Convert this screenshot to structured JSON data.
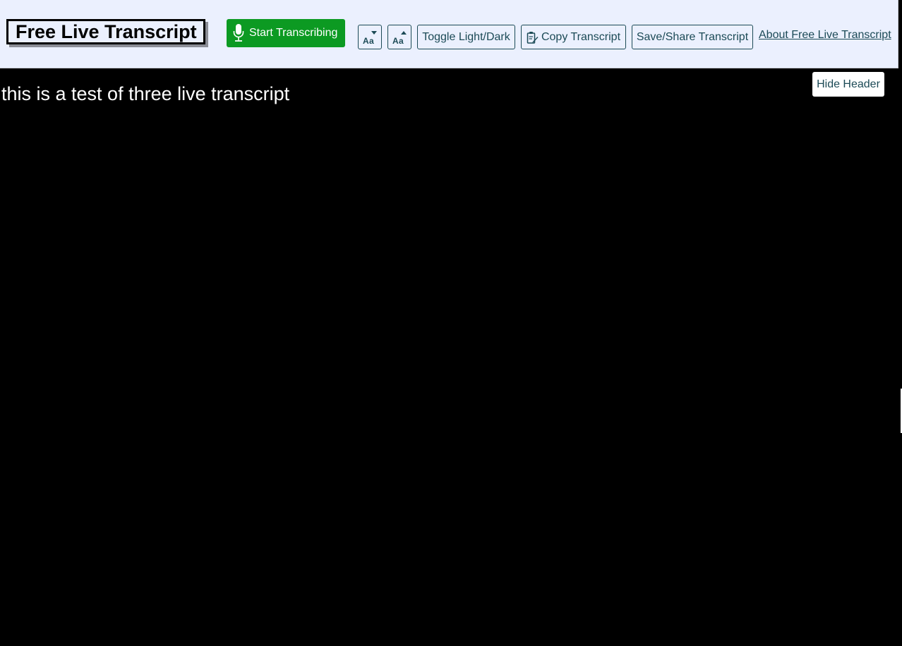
{
  "header": {
    "title": "Free Live Transcript",
    "start_button": "Start Transcribing",
    "toggle_theme": "Toggle Light/Dark",
    "copy_transcript": "Copy Transcript",
    "save_share": "Save/Share Transcript",
    "about_link": "About Free Live Transcript",
    "icons": {
      "start": "microphone-icon",
      "decrease_font": "decrease-text-size-icon",
      "increase_font": "increase-text-size-icon",
      "copy": "clipboard-edit-icon"
    }
  },
  "transcript": {
    "text": "this is a test of three live transcript"
  },
  "hide_header_button": "Hide Header",
  "colors": {
    "header_bg": "#ebf0fe",
    "accent_green": "#0c9a22",
    "button_text": "#1c4a56",
    "page_bg": "#000000",
    "transcript_text": "#ffffff"
  }
}
